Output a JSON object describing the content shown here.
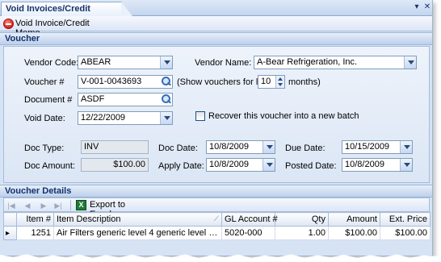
{
  "window": {
    "title": "Void Invoices/Credit Memos",
    "pin_glyph": "▾",
    "close_glyph": "✕"
  },
  "toolbar": {
    "void_label": "Void Invoice/Credit Memo",
    "void_icon": "void-icon"
  },
  "voucher_section": {
    "header": "Voucher",
    "vendor_code_label": "Vendor Code:",
    "vendor_code": "ABEAR",
    "vendor_name_label": "Vendor Name:",
    "vendor_name": "A-Bear Refrigeration, Inc.",
    "voucher_label": "Voucher #",
    "voucher": "V-001-0043693",
    "show_vouchers_label": "(Show vouchers for last",
    "months_value": "10",
    "months_label": "months)",
    "document_label": "Document #",
    "document": "ASDF",
    "void_date_label": "Void Date:",
    "void_date": "12/22/2009",
    "recover_label": "Recover this voucher into a new batch",
    "recover_checked": false,
    "doc_type_label": "Doc Type:",
    "doc_type": "INV",
    "doc_date_label": "Doc Date:",
    "doc_date": "10/8/2009",
    "due_date_label": "Due Date:",
    "due_date": "10/15/2009",
    "doc_amount_label": "Doc Amount:",
    "doc_amount": "$100.00",
    "apply_date_label": "Apply Date:",
    "apply_date": "10/8/2009",
    "posted_date_label": "Posted Date:",
    "posted_date": "10/8/2009"
  },
  "details_section": {
    "header": "Voucher Details",
    "nav_first": "|◀",
    "nav_prev": "◀",
    "nav_next": "▶",
    "nav_last": "▶|",
    "export_label": "Export to Excel",
    "export_icon_text": "X",
    "columns": {
      "item_no": "Item #",
      "item_desc": "Item Description",
      "gl_account": "GL Account #",
      "qty": "Qty",
      "amount": "Amount",
      "ext_price": "Ext. Price"
    },
    "rows": [
      {
        "item_no": "1251",
        "item_desc": "Air Filters generic level 4 generic level 5 generic l...",
        "gl_account": "5020-000",
        "qty": "1.00",
        "amount": "$100.00",
        "ext_price": "$100.00"
      }
    ]
  }
}
